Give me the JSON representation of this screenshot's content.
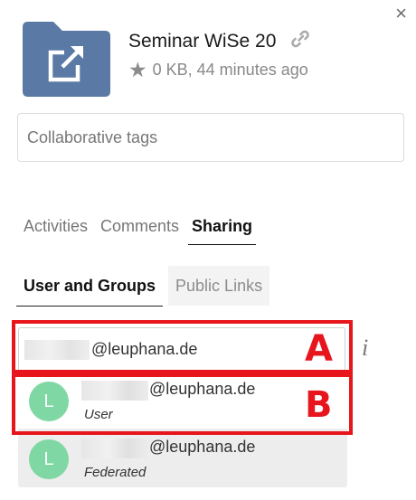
{
  "header": {
    "close_glyph": "×",
    "file_name": "Seminar WiSe 20",
    "size": "0 KB, 44 minutes ago",
    "icons": {
      "folder": "shared-folder-icon",
      "link": "link-icon",
      "star": "star-icon",
      "close": "close-icon"
    }
  },
  "tags": {
    "placeholder": "Collaborative tags"
  },
  "tabs": [
    {
      "label": "Activities",
      "active": false
    },
    {
      "label": "Comments",
      "active": false
    },
    {
      "label": "Sharing",
      "active": true
    }
  ],
  "subtabs": [
    {
      "label": "User and Groups",
      "active": true
    },
    {
      "label": "Public Links",
      "active": false
    }
  ],
  "share_input": {
    "value": "@leuphana.de"
  },
  "info_glyph": "i",
  "suggestions": [
    {
      "avatar": "L",
      "email": "@leuphana.de",
      "type": "User"
    },
    {
      "avatar": "L",
      "email": "@leuphana.de",
      "type": "Federated"
    }
  ],
  "annotations": {
    "a": "A",
    "b": "B",
    "color": "#e6161c"
  },
  "colors": {
    "folder": "#5a7aa5",
    "avatar": "#7fd8a4"
  }
}
